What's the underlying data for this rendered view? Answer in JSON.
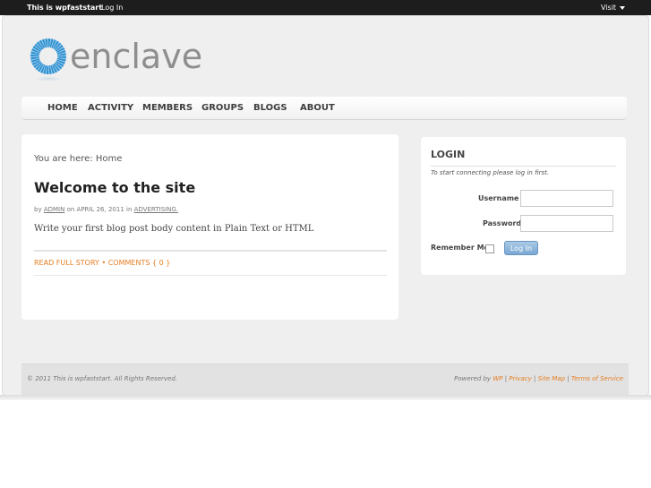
{
  "adminbar": {
    "site_name": "This is wpfaststart",
    "login": "Log In",
    "visit": "Visit"
  },
  "logo": {
    "text": "enclave",
    "icon": "sunburst-logo-icon"
  },
  "nav": [
    "HOME",
    "ACTIVITY",
    "MEMBERS",
    "GROUPS",
    "BLOGS",
    "ABOUT"
  ],
  "post": {
    "breadcrumb": "You are here: Home",
    "title": "Welcome to the site",
    "meta_by": "by",
    "author": "ADMIN",
    "meta_on": "on APRIL 26, 2011 in",
    "category": "ADVERTISING.",
    "body": "Write your first blog post body content in Plain Text or HTML",
    "read_more": "READ FULL STORY",
    "bullet": "•",
    "comments": "COMMENTS { 0 }"
  },
  "login": {
    "title": "LOGIN",
    "note": "To start connecting please log in first.",
    "username_label": "Username",
    "password_label": "Password",
    "remember_label": "Remember Me",
    "button": "Log In"
  },
  "footer": {
    "copyright": "© 2011 This is wpfaststart. All Rights Reserved.",
    "powered_by": "Powered by",
    "wp": "WP",
    "privacy": "Privacy",
    "sitemap": "Site Map",
    "terms": "Terms of Service",
    "sep": "|"
  },
  "colors": {
    "accent": "#e57d22",
    "logo_blue": "#2d8fcf",
    "adminbar": "#1d1d1d"
  }
}
